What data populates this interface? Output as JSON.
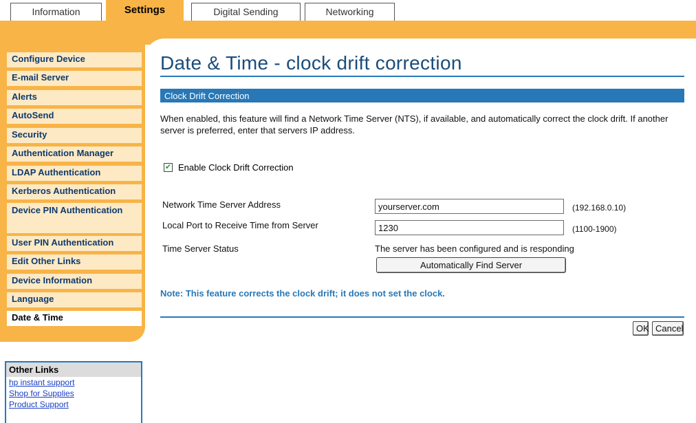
{
  "tabs": [
    {
      "label": "Information",
      "active": false
    },
    {
      "label": "Settings",
      "active": true
    },
    {
      "label": "Digital Sending",
      "active": false
    },
    {
      "label": "Networking",
      "active": false
    }
  ],
  "nav": {
    "items": [
      {
        "label": "Configure Device"
      },
      {
        "label": "E-mail Server"
      },
      {
        "label": "Alerts"
      },
      {
        "label": "AutoSend"
      },
      {
        "label": "Security"
      },
      {
        "label": "Authentication Manager"
      },
      {
        "label": "LDAP Authentication"
      },
      {
        "label": "Kerberos Authentication"
      },
      {
        "label": "Device PIN Authentication"
      },
      {
        "label": "User PIN Authentication"
      },
      {
        "label": "Edit Other Links"
      },
      {
        "label": "Device Information"
      },
      {
        "label": "Language"
      },
      {
        "label": "Date & Time",
        "selected": true
      }
    ]
  },
  "other_links": {
    "title": "Other Links",
    "links": [
      "hp instant support",
      "Shop for Supplies",
      "Product Support"
    ]
  },
  "main": {
    "title": "Date & Time - clock drift correction",
    "section_title": "Clock Drift Correction",
    "description": "When enabled, this feature will find a Network Time Server (NTS), if available, and automatically correct the clock drift. If another server is preferred, enter that servers IP address.",
    "enable_label": "Enable Clock Drift Correction",
    "enable_checked": true,
    "server_address_label": "Network Time Server Address",
    "server_address_value": "yourserver.com",
    "server_address_hint": "(192.168.0.10)",
    "port_label": "Local Port to Receive Time from Server",
    "port_value": "1230",
    "port_hint": "(1100-1900)",
    "status_label": "Time Server Status",
    "status_value": "The server has been configured and is responding",
    "find_button": "Automatically Find Server",
    "note": "Note: This feature corrects the clock drift; it does not set the clock.",
    "ok_button": "OK",
    "cancel_button": "Cancel"
  },
  "colors": {
    "accent_orange": "#f8b447",
    "accent_blue": "#2878b7",
    "nav_text": "#0f3a6b"
  }
}
